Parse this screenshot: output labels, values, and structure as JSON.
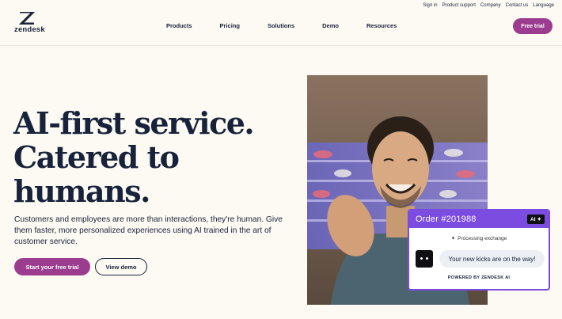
{
  "utility_nav": [
    "Sign in",
    "Product support",
    "Company",
    "Contact us",
    "Language"
  ],
  "logo": {
    "text": "zendesk"
  },
  "nav": [
    "Products",
    "Pricing",
    "Solutions",
    "Demo",
    "Resources"
  ],
  "header_cta": "Free trial",
  "hero": {
    "title_lines": [
      "AI-first service.",
      "Catered to",
      "humans."
    ],
    "subtitle": "Customers and employees are more than interactions, they're human. Give them faster, more personalized experiences using AI trained in the art of customer service.",
    "primary_cta": "Start your free trial",
    "secondary_cta": "View demo"
  },
  "chat_card": {
    "title": "Order #201988",
    "badge": "AI",
    "status": "Processing exchange",
    "message": "Your new kicks are on the way!",
    "footer": "POWERED BY ZENDESK AI"
  },
  "colors": {
    "brand_purple": "#9b3c8e",
    "card_accent": "#7c4be0",
    "ink": "#17233a",
    "background": "#fdf9f3"
  }
}
